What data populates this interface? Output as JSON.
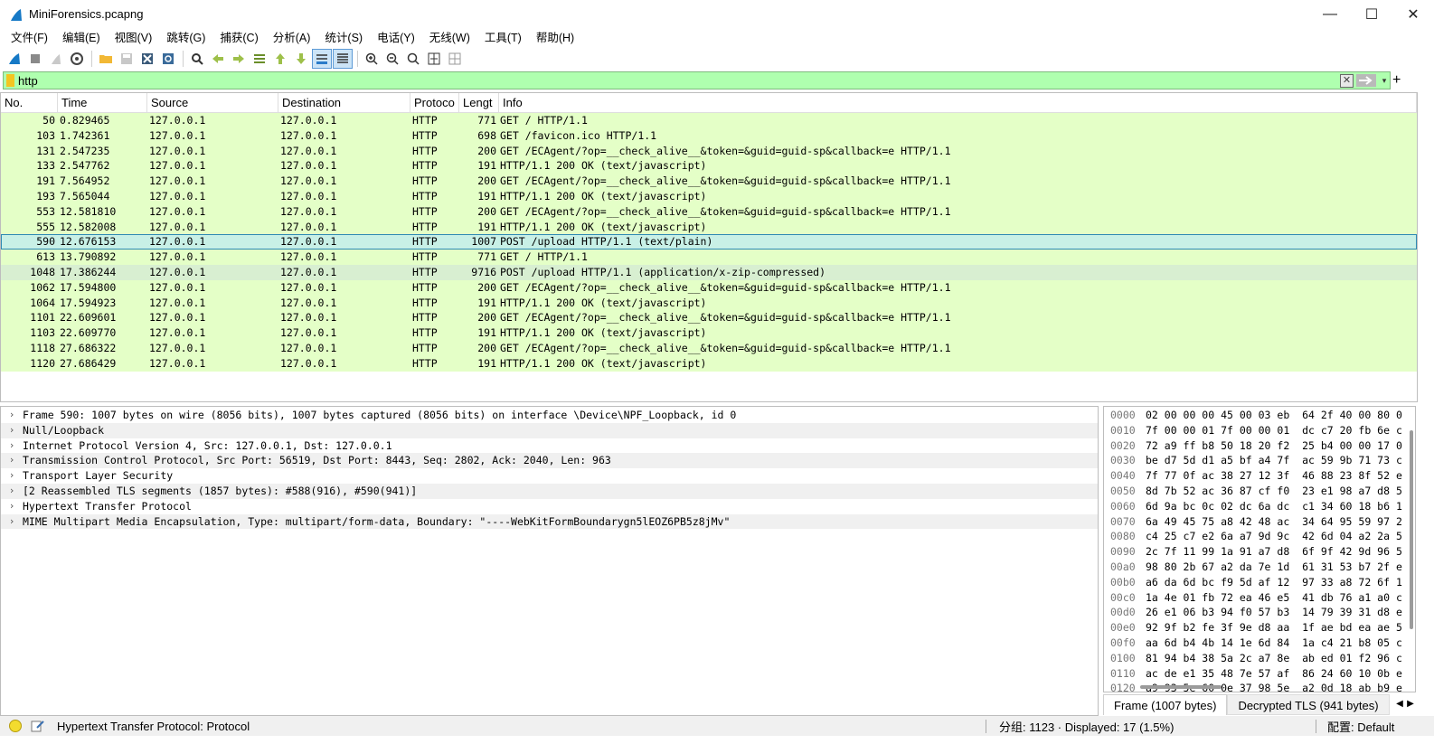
{
  "window": {
    "title": "MiniForensics.pcapng",
    "controls": {
      "minimize": "—",
      "maximize": "☐",
      "close": "✕"
    }
  },
  "menu": [
    "文件(F)",
    "编辑(E)",
    "视图(V)",
    "跳转(G)",
    "捕获(C)",
    "分析(A)",
    "统计(S)",
    "电话(Y)",
    "无线(W)",
    "工具(T)",
    "帮助(H)"
  ],
  "toolbar": [
    "shark-fin-start-icon",
    "stop-square-icon",
    "restart-fin-icon",
    "capture-options-gear-icon",
    "open-folder-icon",
    "save-file-icon",
    "close-file-icon",
    "reload-file-icon",
    "find-packet-icon",
    "go-back-arrow-icon",
    "go-forward-arrow-icon",
    "go-to-packet-icon",
    "go-first-icon",
    "go-last-icon",
    "autoscroll-icon",
    "colorize-icon",
    "zoom-in-icon",
    "zoom-out-icon",
    "zoom-normal-icon",
    "resize-columns-icon",
    "layout-grid-icon"
  ],
  "filter": {
    "value": "http",
    "clear": "✕",
    "dropdown": "▾",
    "add": "+"
  },
  "columns": [
    "No.",
    "Time",
    "Source",
    "Destination",
    "Protoco",
    "Lengt",
    "Info"
  ],
  "packets": [
    {
      "no": "50",
      "time": "0.829465",
      "src": "127.0.0.1",
      "dst": "127.0.0.1",
      "proto": "HTTP",
      "len": "771",
      "info": "GET / HTTP/1.1"
    },
    {
      "no": "103",
      "time": "1.742361",
      "src": "127.0.0.1",
      "dst": "127.0.0.1",
      "proto": "HTTP",
      "len": "698",
      "info": "GET /favicon.ico HTTP/1.1"
    },
    {
      "no": "131",
      "time": "2.547235",
      "src": "127.0.0.1",
      "dst": "127.0.0.1",
      "proto": "HTTP",
      "len": "200",
      "info": "GET /ECAgent/?op=__check_alive__&token=&guid=guid-sp&callback=e HTTP/1.1"
    },
    {
      "no": "133",
      "time": "2.547762",
      "src": "127.0.0.1",
      "dst": "127.0.0.1",
      "proto": "HTTP",
      "len": "191",
      "info": "HTTP/1.1 200 OK  (text/javascript)"
    },
    {
      "no": "191",
      "time": "7.564952",
      "src": "127.0.0.1",
      "dst": "127.0.0.1",
      "proto": "HTTP",
      "len": "200",
      "info": "GET /ECAgent/?op=__check_alive__&token=&guid=guid-sp&callback=e HTTP/1.1"
    },
    {
      "no": "193",
      "time": "7.565044",
      "src": "127.0.0.1",
      "dst": "127.0.0.1",
      "proto": "HTTP",
      "len": "191",
      "info": "HTTP/1.1 200 OK  (text/javascript)"
    },
    {
      "no": "553",
      "time": "12.581810",
      "src": "127.0.0.1",
      "dst": "127.0.0.1",
      "proto": "HTTP",
      "len": "200",
      "info": "GET /ECAgent/?op=__check_alive__&token=&guid=guid-sp&callback=e HTTP/1.1"
    },
    {
      "no": "555",
      "time": "12.582008",
      "src": "127.0.0.1",
      "dst": "127.0.0.1",
      "proto": "HTTP",
      "len": "191",
      "info": "HTTP/1.1 200 OK  (text/javascript)"
    },
    {
      "no": "590",
      "time": "12.676153",
      "src": "127.0.0.1",
      "dst": "127.0.0.1",
      "proto": "HTTP",
      "len": "1007",
      "info": "POST /upload HTTP/1.1  (text/plain)"
    },
    {
      "no": "613",
      "time": "13.790892",
      "src": "127.0.0.1",
      "dst": "127.0.0.1",
      "proto": "HTTP",
      "len": "771",
      "info": "GET / HTTP/1.1"
    },
    {
      "no": "1048",
      "time": "17.386244",
      "src": "127.0.0.1",
      "dst": "127.0.0.1",
      "proto": "HTTP",
      "len": "9716",
      "info": "POST /upload HTTP/1.1  (application/x-zip-compressed)"
    },
    {
      "no": "1062",
      "time": "17.594800",
      "src": "127.0.0.1",
      "dst": "127.0.0.1",
      "proto": "HTTP",
      "len": "200",
      "info": "GET /ECAgent/?op=__check_alive__&token=&guid=guid-sp&callback=e HTTP/1.1"
    },
    {
      "no": "1064",
      "time": "17.594923",
      "src": "127.0.0.1",
      "dst": "127.0.0.1",
      "proto": "HTTP",
      "len": "191",
      "info": "HTTP/1.1 200 OK  (text/javascript)"
    },
    {
      "no": "1101",
      "time": "22.609601",
      "src": "127.0.0.1",
      "dst": "127.0.0.1",
      "proto": "HTTP",
      "len": "200",
      "info": "GET /ECAgent/?op=__check_alive__&token=&guid=guid-sp&callback=e HTTP/1.1"
    },
    {
      "no": "1103",
      "time": "22.609770",
      "src": "127.0.0.1",
      "dst": "127.0.0.1",
      "proto": "HTTP",
      "len": "191",
      "info": "HTTP/1.1 200 OK  (text/javascript)"
    },
    {
      "no": "1118",
      "time": "27.686322",
      "src": "127.0.0.1",
      "dst": "127.0.0.1",
      "proto": "HTTP",
      "len": "200",
      "info": "GET /ECAgent/?op=__check_alive__&token=&guid=guid-sp&callback=e HTTP/1.1"
    },
    {
      "no": "1120",
      "time": "27.686429",
      "src": "127.0.0.1",
      "dst": "127.0.0.1",
      "proto": "HTTP",
      "len": "191",
      "info": "HTTP/1.1 200 OK  (text/javascript)"
    }
  ],
  "selected_packet": "590",
  "related_packet": "1048",
  "details": [
    "Frame 590: 1007 bytes on wire (8056 bits), 1007 bytes captured (8056 bits) on interface \\Device\\NPF_Loopback, id 0",
    "Null/Loopback",
    "Internet Protocol Version 4, Src: 127.0.0.1, Dst: 127.0.0.1",
    "Transmission Control Protocol, Src Port: 56519, Dst Port: 8443, Seq: 2802, Ack: 2040, Len: 963",
    "Transport Layer Security",
    "[2 Reassembled TLS segments (1857 bytes): #588(916), #590(941)]",
    "Hypertext Transfer Protocol",
    "MIME Multipart Media Encapsulation, Type: multipart/form-data, Boundary: \"----WebKitFormBoundarygn5lEOZ6PB5z8jMv\""
  ],
  "bytes": [
    {
      "off": "0000",
      "hex": "02 00 00 00 45 00 03 eb  64 2f 40 00 80 0"
    },
    {
      "off": "0010",
      "hex": "7f 00 00 01 7f 00 00 01  dc c7 20 fb 6e c"
    },
    {
      "off": "0020",
      "hex": "72 a9 ff b8 50 18 20 f2  25 b4 00 00 17 0"
    },
    {
      "off": "0030",
      "hex": "be d7 5d d1 a5 bf a4 7f  ac 59 9b 71 73 c"
    },
    {
      "off": "0040",
      "hex": "7f 77 0f ac 38 27 12 3f  46 88 23 8f 52 e"
    },
    {
      "off": "0050",
      "hex": "8d 7b 52 ac 36 87 cf f0  23 e1 98 a7 d8 5"
    },
    {
      "off": "0060",
      "hex": "6d 9a bc 0c 02 dc 6a dc  c1 34 60 18 b6 1"
    },
    {
      "off": "0070",
      "hex": "6a 49 45 75 a8 42 48 ac  34 64 95 59 97 2"
    },
    {
      "off": "0080",
      "hex": "c4 25 c7 e2 6a a7 9d 9c  42 6d 04 a2 2a 5"
    },
    {
      "off": "0090",
      "hex": "2c 7f 11 99 1a 91 a7 d8  6f 9f 42 9d 96 5"
    },
    {
      "off": "00a0",
      "hex": "98 80 2b 67 a2 da 7e 1d  61 31 53 b7 2f e"
    },
    {
      "off": "00b0",
      "hex": "a6 da 6d bc f9 5d af 12  97 33 a8 72 6f 1"
    },
    {
      "off": "00c0",
      "hex": "1a 4e 01 fb 72 ea 46 e5  41 db 76 a1 a0 c"
    },
    {
      "off": "00d0",
      "hex": "26 e1 06 b3 94 f0 57 b3  14 79 39 31 d8 e"
    },
    {
      "off": "00e0",
      "hex": "92 9f b2 fe 3f 9e d8 aa  1f ae bd ea ae 5"
    },
    {
      "off": "00f0",
      "hex": "aa 6d b4 4b 14 1e 6d 84  1a c4 21 b8 05 c"
    },
    {
      "off": "0100",
      "hex": "81 94 b4 38 5a 2c a7 8e  ab ed 01 f2 96 c"
    },
    {
      "off": "0110",
      "hex": "ac de e1 35 48 7e 57 af  86 24 60 10 0b e"
    },
    {
      "off": "0120",
      "hex": "a9 93 5e 60 0e 37 98 5e  a2 0d 18 ab b9 e"
    },
    {
      "off": "0130",
      "hex": "2d b1 08 53 80 ec fc f7  4b f1 d6 32 f2 e"
    }
  ],
  "bytes_tabs": [
    "Frame (1007 bytes)",
    "Decrypted TLS (941 bytes)"
  ],
  "status": {
    "field": "Hypertext Transfer Protocol: Protocol",
    "stats": "分组: 1123 · Displayed: 17 (1.5%)",
    "profile": "配置: Default"
  },
  "colors": {
    "row_bg": "#e4ffc7",
    "selected_bg": "#c8f0e6",
    "filter_bg": "#afffaf"
  }
}
